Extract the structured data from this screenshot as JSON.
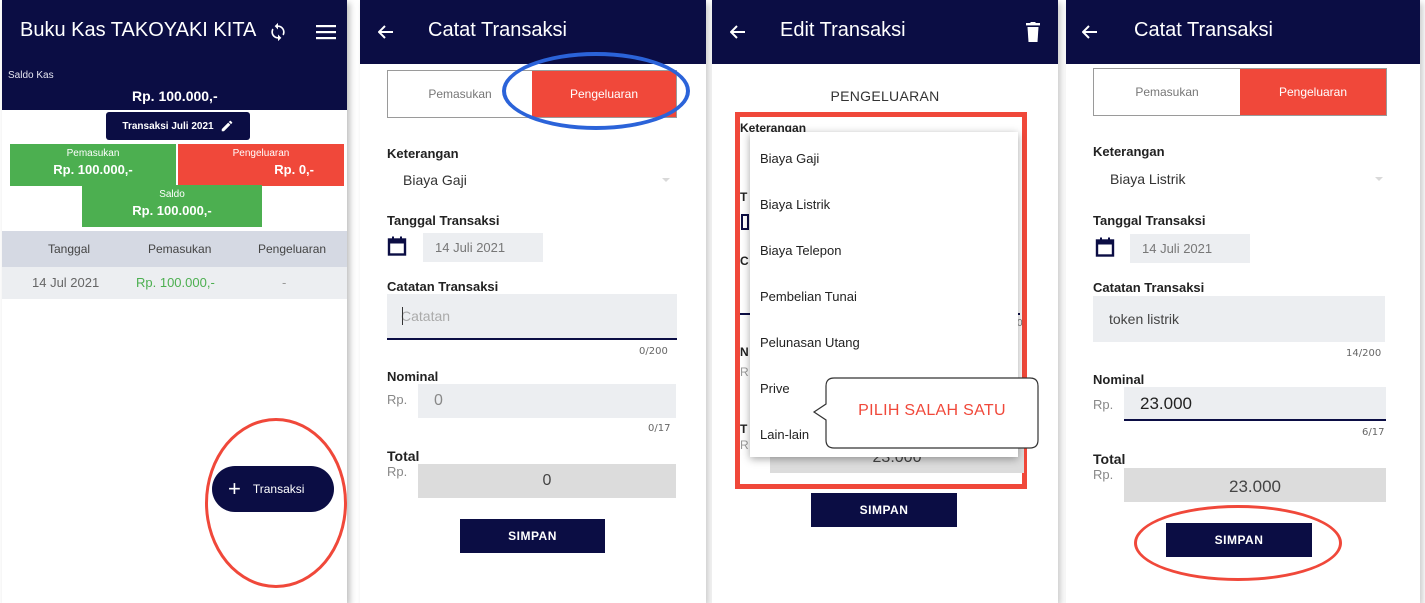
{
  "colors": {
    "navy": "#0b0d44",
    "red": "#f0483a",
    "green": "#4caf50",
    "income_green": "#4caf50",
    "highlight_blue": "#2b63d9"
  },
  "screen1": {
    "title": "Buku Kas TAKOYAKI KITA",
    "icons": [
      "refresh-icon",
      "menu-icon"
    ],
    "saldo_kas_label": "Saldo Kas",
    "saldo_kas_value": "Rp. 100.000,-",
    "period_button": "Transaksi Juli 2021",
    "pemasukan_label": "Pemasukan",
    "pemasukan_value": "Rp. 100.000,-",
    "pengeluaran_label": "Pengeluaran",
    "pengeluaran_value": "Rp. 0,-",
    "saldo_label": "Saldo",
    "saldo_value": "Rp. 100.000,-",
    "table": {
      "headers": [
        "Tanggal",
        "Pemasukan",
        "Pengeluaran"
      ],
      "rows": [
        [
          "14 Jul 2021",
          "Rp. 100.000,-",
          "-"
        ]
      ]
    },
    "fab_label": "Transaksi"
  },
  "screen2": {
    "title": "Catat Transaksi",
    "tab_income": "Pemasukan",
    "tab_expense": "Pengeluaran",
    "keterangan_label": "Keterangan",
    "keterangan_value": "Biaya Gaji",
    "tanggal_label": "Tanggal Transaksi",
    "tanggal_value": "14 Juli 2021",
    "catatan_label": "Catatan Transaksi",
    "catatan_placeholder": "Catatan",
    "catatan_counter": "0/200",
    "nominal_label": "Nominal",
    "nominal_prefix": "Rp.",
    "nominal_value": "0",
    "nominal_counter": "0/17",
    "total_label": "Total",
    "total_prefix": "Rp.",
    "total_value": "0",
    "save_button": "SIMPAN"
  },
  "screen3": {
    "title": "Edit Transaksi",
    "heading": "PENGELUARAN",
    "keterangan_label": "Keterangan",
    "dropdown_options": [
      "Biaya Gaji",
      "Biaya Listrik",
      "Biaya Telepon",
      "Pembelian Tunai",
      "Pelunasan Utang",
      "Prive",
      "Lain-lain"
    ],
    "callout": "PILIH SALAH SATU",
    "partial_total": "23.000",
    "save_button": "SIMPAN"
  },
  "screen4": {
    "title": "Catat Transaksi",
    "tab_income": "Pemasukan",
    "tab_expense": "Pengeluaran",
    "keterangan_label": "Keterangan",
    "keterangan_value": "Biaya Listrik",
    "tanggal_label": "Tanggal Transaksi",
    "tanggal_value": "14 Juli 2021",
    "catatan_label": "Catatan Transaksi",
    "catatan_value": "token listrik",
    "catatan_counter": "14/200",
    "nominal_label": "Nominal",
    "nominal_prefix": "Rp.",
    "nominal_value": "23.000",
    "nominal_counter": "6/17",
    "total_label": "Total",
    "total_prefix": "Rp.",
    "total_value": "23.000",
    "save_button": "SIMPAN"
  }
}
